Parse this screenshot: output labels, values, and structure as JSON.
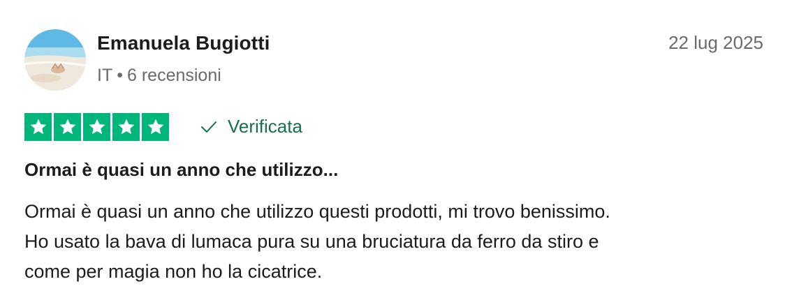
{
  "review": {
    "reviewer_name": "Emanuela Bugiotti",
    "country": "IT",
    "separator": "•",
    "review_count": "6 recensioni",
    "date": "22 lug 2025",
    "rating": 5,
    "rating_max": 5,
    "verified_label": "Verificata",
    "title": "Ormai è quasi un anno che utilizzo...",
    "body_lines": [
      "Ormai è quasi un anno che utilizzo questi prodotti, mi trovo benissimo.",
      "Ho usato la bava di lumaca pura su una bruciatura da ferro da stiro e",
      "come per magia non ho la cicatrice."
    ]
  },
  "colors": {
    "star_green": "#00b67a",
    "verified_green": "#15704a",
    "text_dark": "#1c1c1c",
    "text_muted": "#696a6a"
  },
  "icons": {
    "star": "star-icon",
    "verified": "check-icon"
  }
}
